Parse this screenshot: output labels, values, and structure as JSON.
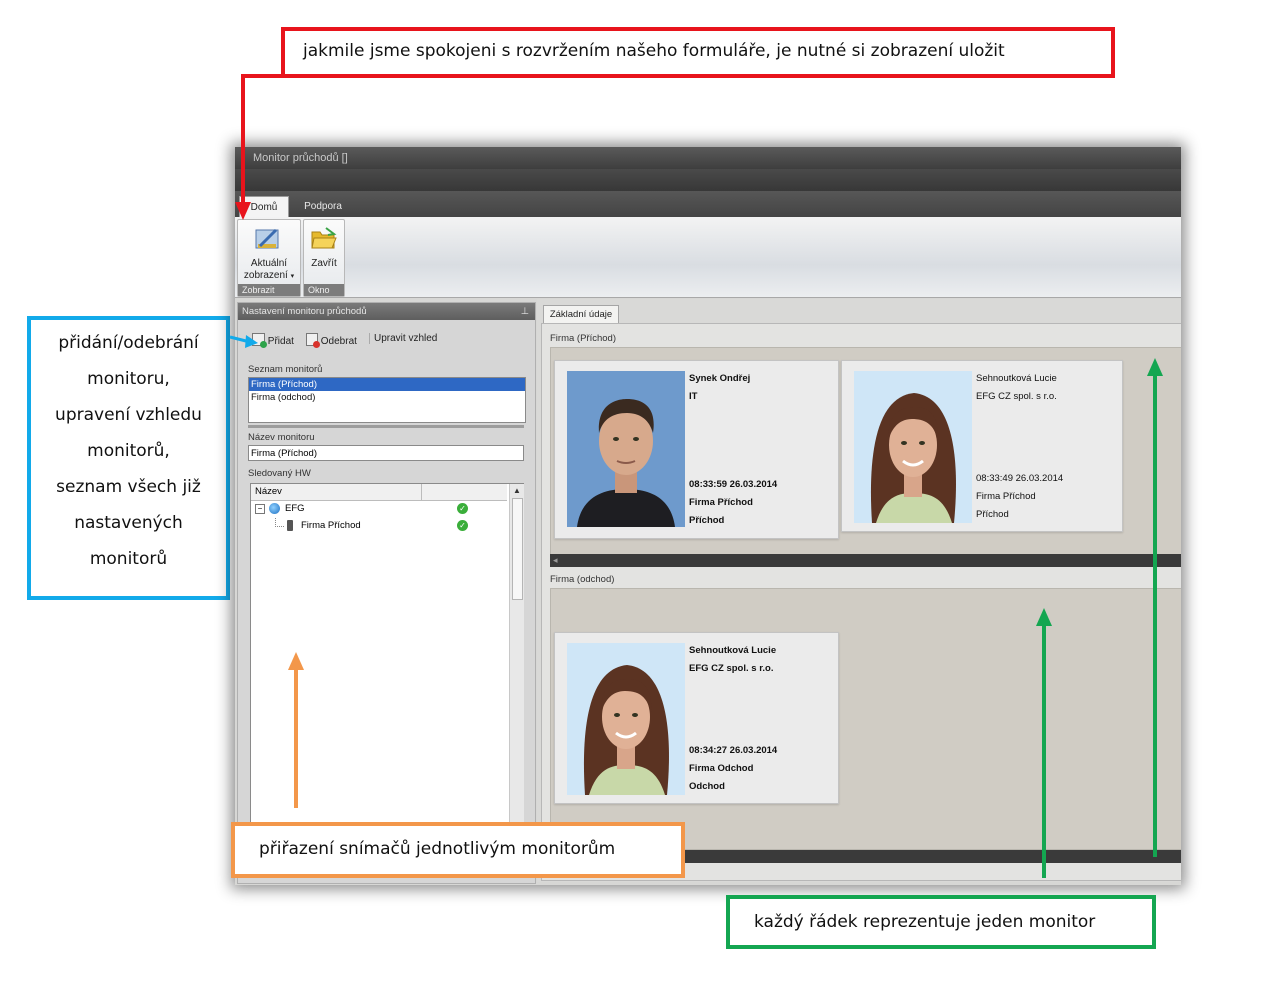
{
  "annotations": {
    "save_view": "jakmile jsme spokojeni s rozvržením našeho formuláře, je nutné si zobrazení uložit",
    "add_remove_lines": [
      "přidání/odebrání",
      "monitoru,",
      "upravení vzhledu",
      "monitorů,",
      "seznam všech již",
      "nastavených",
      "monitorů"
    ],
    "assign_readers": "přiřazení snímačů jednotlivým monitorům",
    "each_row": "každý řádek reprezentuje jeden monitor"
  },
  "window": {
    "title": "Monitor průchodů []",
    "ribbon_tabs": [
      "Domů",
      "Podpora"
    ],
    "ribbon_buttons": {
      "current_view_line1": "Aktuální",
      "current_view_line2": "zobrazení",
      "close": "Zavřít"
    },
    "ribbon_groups": [
      "Zobrazit",
      "Okno"
    ]
  },
  "left_panel": {
    "title": "Nastavení monitoru průchodů",
    "toolbar": {
      "add": "Přidat",
      "remove": "Odebrat",
      "edit_view": "Upravit vzhled"
    },
    "monitors_label": "Seznam monitorů",
    "monitors": [
      "Firma (Příchod)",
      "Firma (odchod)"
    ],
    "name_label": "Název monitoru",
    "name_value": "Firma (Příchod)",
    "hw_label": "Sledovaný HW",
    "tree_header": "Název",
    "tree_items": [
      "EFG",
      "Firma Příchod"
    ]
  },
  "right_panel": {
    "tab": "Základní údaje",
    "monitors": [
      {
        "label": "Firma (Příchod)",
        "cards": [
          {
            "name": "Synek Ondřej",
            "company": "IT",
            "time": "08:33:59 26.03.2014",
            "reader": "Firma Příchod",
            "direction": "Příchod"
          },
          {
            "name": "Sehnoutková Lucie",
            "company": "EFG CZ spol. s r.o.",
            "time": "08:33:49 26.03.2014",
            "reader": "Firma Příchod",
            "direction": "Příchod"
          }
        ]
      },
      {
        "label": "Firma (odchod)",
        "cards": [
          {
            "name": "Sehnoutková Lucie",
            "company": "EFG CZ spol. s r.o.",
            "time": "08:34:27 26.03.2014",
            "reader": "Firma Odchod",
            "direction": "Odchod"
          }
        ]
      }
    ]
  },
  "colors": {
    "red": "#e8141c",
    "blue": "#12aaea",
    "orange": "#f3974a",
    "green": "#14a651"
  }
}
